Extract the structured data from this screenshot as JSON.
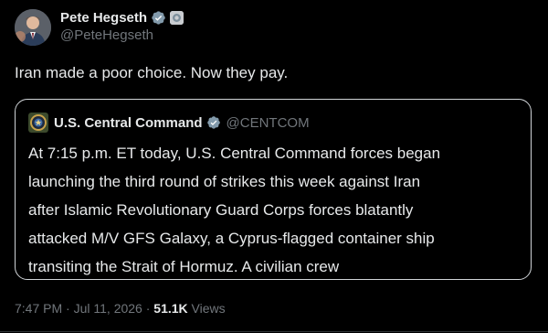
{
  "author": {
    "display_name": "Pete Hegseth",
    "handle": "@PeteHegseth",
    "avatar_icon": "person-photo-avatar",
    "verified_icon": "verified-badge-gray",
    "affiliation_icon": "government-affiliation-badge"
  },
  "tweet": {
    "text": "Iran made a poor choice. Now they pay."
  },
  "quote": {
    "display_name": "U.S. Central Command",
    "handle": "@CENTCOM",
    "avatar_icon": "centcom-seal-icon",
    "verified_icon": "verified-badge-gray",
    "lines": [
      "At 7:15 p.m. ET today, U.S. Central Command forces began",
      "launching the third round of strikes this week against Iran",
      "after Islamic Revolutionary Guard Corps forces blatantly",
      "attacked M/V GFS Galaxy, a Cyprus-flagged container ship",
      "transiting the Strait of Hormuz. A civilian crew"
    ]
  },
  "meta": {
    "time": "7:47 PM",
    "separator1": " · ",
    "date": "Jul 11, 2026",
    "separator2": " · ",
    "views_count": "51.1K",
    "views_label": " Views"
  },
  "colors": {
    "background": "#000000",
    "text": "#e7e9ea",
    "muted": "#71767b",
    "quote_border": "#d0d4d8",
    "verified": "#829aab"
  }
}
